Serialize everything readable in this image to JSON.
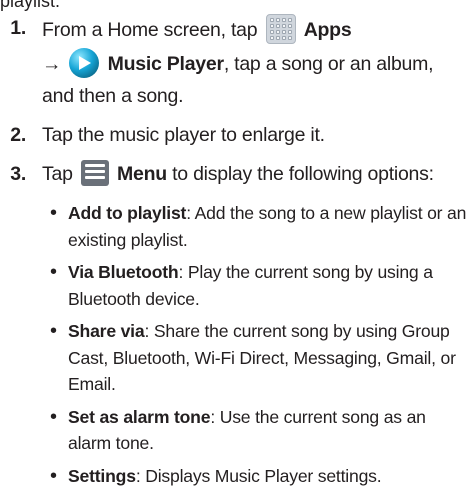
{
  "header_fragment": "playlist.",
  "steps": [
    {
      "number": "1.",
      "pre": "From a Home screen, tap",
      "apps_label": "Apps",
      "arrow": "→",
      "music_label": "Music Player",
      "post": ", tap a song or an album, and then a song.",
      "icons": [
        "apps-icon",
        "music-player-icon"
      ]
    },
    {
      "number": "2.",
      "text": "Tap the music player to enlarge it."
    },
    {
      "number": "3.",
      "pre": "Tap",
      "menu_label": "Menu",
      "post": " to display the following options:",
      "icons": [
        "menu-icon"
      ]
    }
  ],
  "options": [
    {
      "label": "Add to playlist",
      "desc": ": Add the song to a new playlist or an existing playlist."
    },
    {
      "label": "Via Bluetooth",
      "desc": ": Play the current song by using a Bluetooth device."
    },
    {
      "label": "Share via",
      "desc": ": Share the current song by using Group Cast, Bluetooth, Wi-Fi Direct, Messaging, Gmail, or Email."
    },
    {
      "label": "Set as alarm tone",
      "desc": ": Use the current song as an alarm tone."
    },
    {
      "label": "Settings",
      "desc": ": Displays Music Player settings."
    }
  ],
  "colors": {
    "text": "#231f20",
    "music_icon": "#16a5d6",
    "menu_icon": "#6a7079"
  }
}
